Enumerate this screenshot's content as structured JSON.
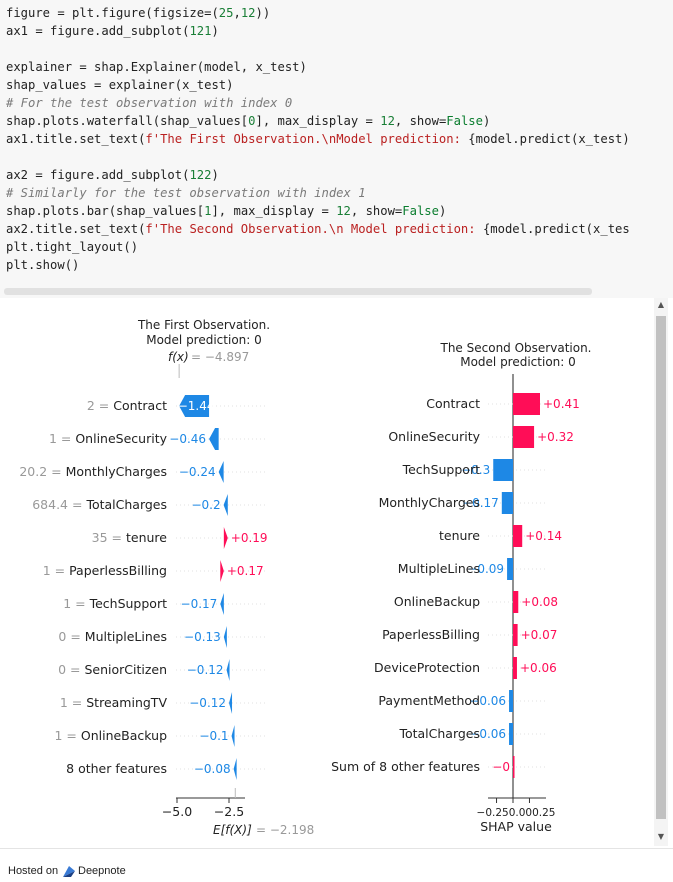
{
  "code": {
    "lines": [
      [
        {
          "t": "figure = plt.figure(figsize=(",
          "c": ""
        },
        {
          "t": "25",
          "c": "num"
        },
        {
          "t": ",",
          "c": ""
        },
        {
          "t": "12",
          "c": "num"
        },
        {
          "t": "))",
          "c": ""
        }
      ],
      [
        {
          "t": "ax1 = figure.add_subplot(",
          "c": ""
        },
        {
          "t": "121",
          "c": "num"
        },
        {
          "t": ")",
          "c": ""
        }
      ],
      [
        {
          "t": "",
          "c": ""
        }
      ],
      [
        {
          "t": "explainer = shap.Explainer(model, x_test)",
          "c": ""
        }
      ],
      [
        {
          "t": "shap_values = explainer(x_test)",
          "c": ""
        }
      ],
      [
        {
          "t": "# For the test observation with index 0",
          "c": "comment"
        }
      ],
      [
        {
          "t": "shap.plots.waterfall(shap_values[",
          "c": ""
        },
        {
          "t": "0",
          "c": "num"
        },
        {
          "t": "], max_display = ",
          "c": ""
        },
        {
          "t": "12",
          "c": "num"
        },
        {
          "t": ", show=",
          "c": ""
        },
        {
          "t": "False",
          "c": "kw"
        },
        {
          "t": ")",
          "c": ""
        }
      ],
      [
        {
          "t": "ax1.title.set_text(",
          "c": ""
        },
        {
          "t": "f'The First Observation.\\nModel prediction: ",
          "c": "str"
        },
        {
          "t": "{model.predict(x_test)",
          "c": ""
        }
      ],
      [
        {
          "t": "",
          "c": ""
        }
      ],
      [
        {
          "t": "ax2 = figure.add_subplot(",
          "c": ""
        },
        {
          "t": "122",
          "c": "num"
        },
        {
          "t": ")",
          "c": ""
        }
      ],
      [
        {
          "t": "# Similarly for the test observation with index 1",
          "c": "comment"
        }
      ],
      [
        {
          "t": "shap.plots.bar(shap_values[",
          "c": ""
        },
        {
          "t": "1",
          "c": "num"
        },
        {
          "t": "], max_display = ",
          "c": ""
        },
        {
          "t": "12",
          "c": "num"
        },
        {
          "t": ", show=",
          "c": ""
        },
        {
          "t": "False",
          "c": "kw"
        },
        {
          "t": ")",
          "c": ""
        }
      ],
      [
        {
          "t": "ax2.title.set_text(",
          "c": ""
        },
        {
          "t": "f'The Second Observation.\\n Model prediction: ",
          "c": "str"
        },
        {
          "t": "{model.predict(x_tes",
          "c": ""
        }
      ],
      [
        {
          "t": "plt.tight_layout()",
          "c": ""
        }
      ],
      [
        {
          "t": "plt.show()",
          "c": ""
        }
      ]
    ]
  },
  "colors": {
    "positive": "#ff0d57",
    "negative": "#1e88e5",
    "muted": "#999999",
    "text": "#222222"
  },
  "chart_data": [
    {
      "type": "bar",
      "title": "The First Observation.\nModel prediction: 0",
      "fx_label": "f(x)",
      "fx_value": "= −4.897",
      "ex_label": "E[f(X)]",
      "ex_value": "= −2.198",
      "xticks": [
        -5.0,
        -2.5
      ],
      "xtick_labels": [
        "−5.0",
        "−2.5"
      ],
      "xlim": [
        -5.2,
        0.5
      ],
      "rows": [
        {
          "value_label": "2",
          "feature": "Contract",
          "shap": -1.44,
          "label": "−1.44"
        },
        {
          "value_label": "1",
          "feature": "OnlineSecurity",
          "shap": -0.46,
          "label": "−0.46"
        },
        {
          "value_label": "20.2",
          "feature": "MonthlyCharges",
          "shap": -0.24,
          "label": "−0.24"
        },
        {
          "value_label": "684.4",
          "feature": "TotalCharges",
          "shap": -0.2,
          "label": "−0.2"
        },
        {
          "value_label": "35",
          "feature": "tenure",
          "shap": 0.19,
          "label": "+0.19"
        },
        {
          "value_label": "1",
          "feature": "PaperlessBilling",
          "shap": 0.17,
          "label": "+0.17"
        },
        {
          "value_label": "1",
          "feature": "TechSupport",
          "shap": -0.17,
          "label": "−0.17"
        },
        {
          "value_label": "0",
          "feature": "MultipleLines",
          "shap": -0.13,
          "label": "−0.13"
        },
        {
          "value_label": "0",
          "feature": "SeniorCitizen",
          "shap": -0.12,
          "label": "−0.12"
        },
        {
          "value_label": "1",
          "feature": "StreamingTV",
          "shap": -0.12,
          "label": "−0.12"
        },
        {
          "value_label": "1",
          "feature": "OnlineBackup",
          "shap": -0.1,
          "label": "−0.1"
        },
        {
          "value_label": "",
          "feature": "8 other features",
          "shap": -0.08,
          "label": "−0.08"
        }
      ]
    },
    {
      "type": "bar",
      "title": "The Second Observation.\n Model prediction: 0",
      "xlabel": "SHAP value",
      "xtick_labels_raw": "−0.250.000.25",
      "xticks": [
        -0.25,
        0.0,
        0.25
      ],
      "xlim": [
        -0.35,
        0.42
      ],
      "rows": [
        {
          "feature": "Contract",
          "shap": 0.41,
          "label": "+0.41"
        },
        {
          "feature": "OnlineSecurity",
          "shap": 0.32,
          "label": "+0.32"
        },
        {
          "feature": "TechSupport",
          "shap": -0.3,
          "label": "−0.3"
        },
        {
          "feature": "MonthlyCharges",
          "shap": -0.17,
          "label": "−0.17"
        },
        {
          "feature": "tenure",
          "shap": 0.14,
          "label": "+0.14"
        },
        {
          "feature": "MultipleLines",
          "shap": -0.09,
          "label": "−0.09"
        },
        {
          "feature": "OnlineBackup",
          "shap": 0.08,
          "label": "+0.08"
        },
        {
          "feature": "PaperlessBilling",
          "shap": 0.07,
          "label": "+0.07"
        },
        {
          "feature": "DeviceProtection",
          "shap": 0.06,
          "label": "+0.06"
        },
        {
          "feature": "PaymentMethod",
          "shap": -0.06,
          "label": "−0.06"
        },
        {
          "feature": "TotalCharges",
          "shap": -0.06,
          "label": "−0.06"
        },
        {
          "feature": "Sum of 8 other features",
          "shap": 0.0,
          "label": "−0"
        }
      ]
    }
  ],
  "footer": {
    "hosted_label": "Hosted on",
    "brand": "Deepnote"
  }
}
